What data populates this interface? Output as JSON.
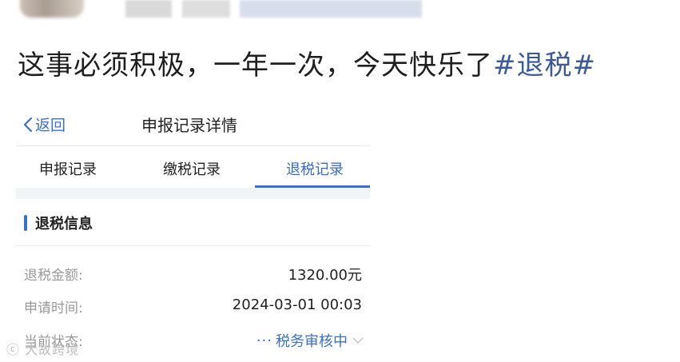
{
  "post": {
    "text": "这事必须积极，一年一次，今天快乐了",
    "hashtag": "#退税#"
  },
  "nav": {
    "back_label": "返回",
    "title": "申报记录详情"
  },
  "tabs": [
    {
      "label": "申报记录",
      "active": false
    },
    {
      "label": "缴税记录",
      "active": false
    },
    {
      "label": "退税记录",
      "active": true
    }
  ],
  "section": {
    "title": "退税信息"
  },
  "details": {
    "amount_label": "退税金额:",
    "amount_value": "1320.00元",
    "time_label": "申请时间:",
    "time_value": "2024-03-01 00:03",
    "status_label": "当前状态:",
    "status_value": "税务审核中"
  },
  "watermark": "大故跨境",
  "colors": {
    "accent": "#3b6fd1",
    "hashtag": "#3a5a9a",
    "label_gray": "#999999"
  }
}
